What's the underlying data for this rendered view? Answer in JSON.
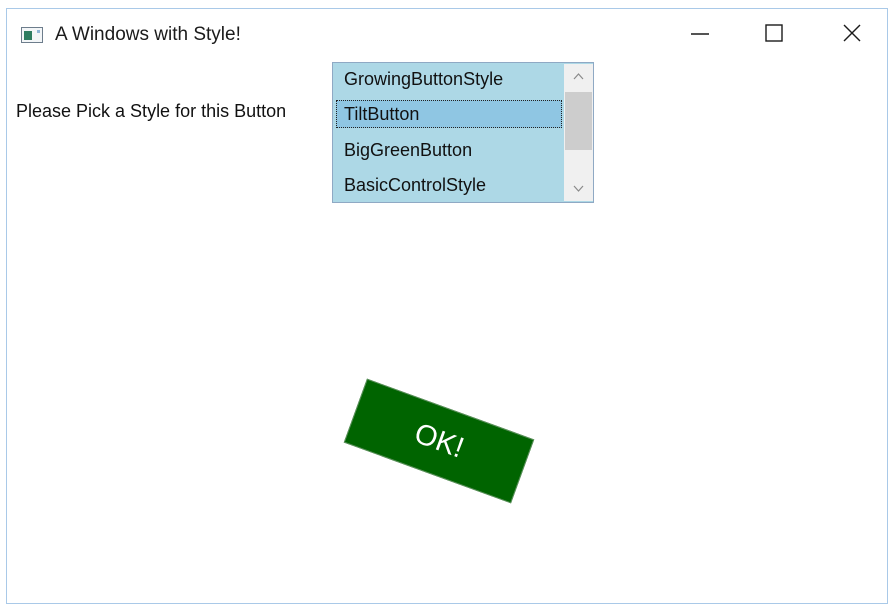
{
  "window": {
    "title": "A Windows with Style!",
    "icon": "app-window-icon",
    "caption_buttons": [
      "minimize-icon",
      "maximize-icon",
      "close-icon"
    ]
  },
  "main": {
    "prompt_label": "Please Pick a Style for this Button",
    "style_list": {
      "items": [
        {
          "label": "GrowingButtonStyle",
          "selected": false
        },
        {
          "label": "TiltButton",
          "selected": true
        },
        {
          "label": "BigGreenButton",
          "selected": false
        },
        {
          "label": "BasicControlStyle",
          "selected": false
        }
      ],
      "selected_value": "TiltButton"
    },
    "ok_button": {
      "label": "OK!",
      "background": "#006400"
    }
  },
  "colors": {
    "listbox_bg": "#add8e6",
    "selected_item_bg": "#8fc6e3"
  }
}
